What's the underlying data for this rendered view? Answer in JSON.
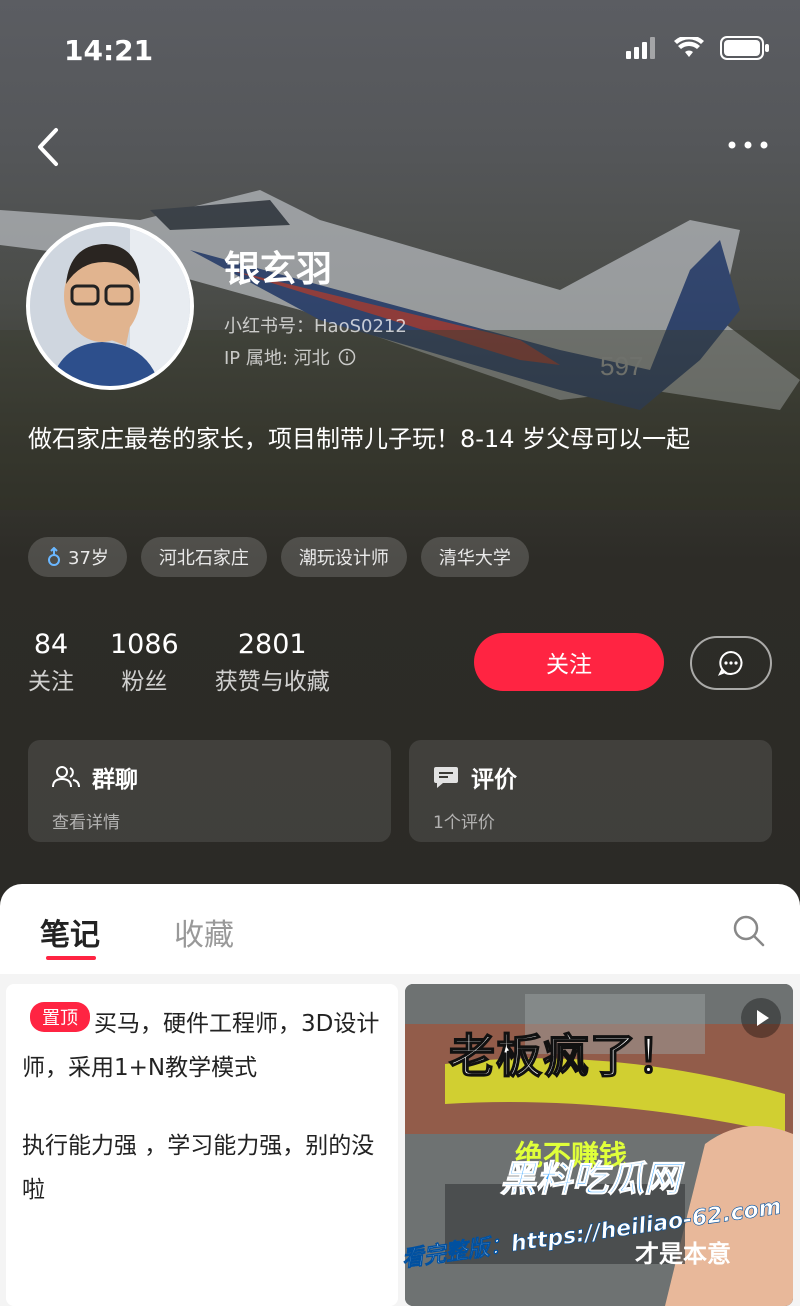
{
  "status_bar": {
    "time": "14:21"
  },
  "profile": {
    "name": "银玄羽",
    "red_id_label": "小红书号：",
    "red_id": "HaoS0212",
    "ip_label": "IP 属地: 河北",
    "bio": "做石家庄最卷的家长，项目制带儿子玩！8-14 岁父母可以一起",
    "tags": [
      {
        "label": "37岁",
        "icon": "male-icon"
      },
      {
        "label": "河北石家庄"
      },
      {
        "label": "潮玩设计师"
      },
      {
        "label": "清华大学"
      }
    ],
    "stats": [
      {
        "num": "84",
        "label": "关注"
      },
      {
        "num": "1086",
        "label": "粉丝"
      },
      {
        "num": "2801",
        "label": "获赞与收藏"
      }
    ],
    "follow_label": "关注",
    "cards": [
      {
        "title": "群聊",
        "sub": "查看详情",
        "icon": "group-icon"
      },
      {
        "title": "评价",
        "sub": "1个评价",
        "icon": "comment-icon"
      }
    ]
  },
  "content_tabs": [
    {
      "label": "笔记"
    },
    {
      "label": "收藏"
    }
  ],
  "notes": {
    "pinned_label": "置顶",
    "line1": "买马，硬件工程师，3D设计师，采用1+N教学模式",
    "line2": "执行能力强 ，学习能力强，别的没啦",
    "video_title": "老板疯了！",
    "video_sub": "绝不赚钱",
    "video_caption": "才是本意"
  },
  "watermark": {
    "cn": "黑料吃瓜网",
    "url": "看完整版：https://heiliao-62.com"
  },
  "colors": {
    "accent": "#ff2442"
  }
}
